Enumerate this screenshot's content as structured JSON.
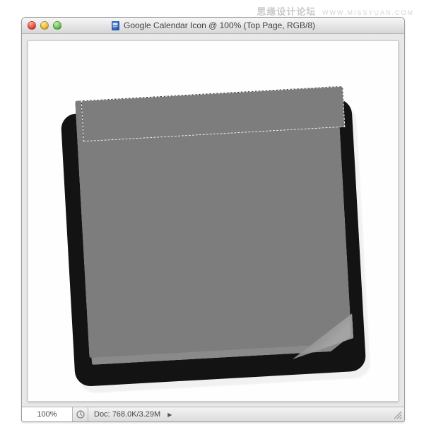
{
  "watermark": {
    "main": "思缘设计论坛",
    "sub": "WWW.MISSYUAN.COM"
  },
  "window": {
    "title": "Google Calendar Icon @ 100% (Top Page, RGB/8)",
    "app_icon": "photoshop-file-icon"
  },
  "statusbar": {
    "zoom": "100%",
    "doc_label": "Doc:",
    "doc_value": "768.0K/3.29M"
  }
}
